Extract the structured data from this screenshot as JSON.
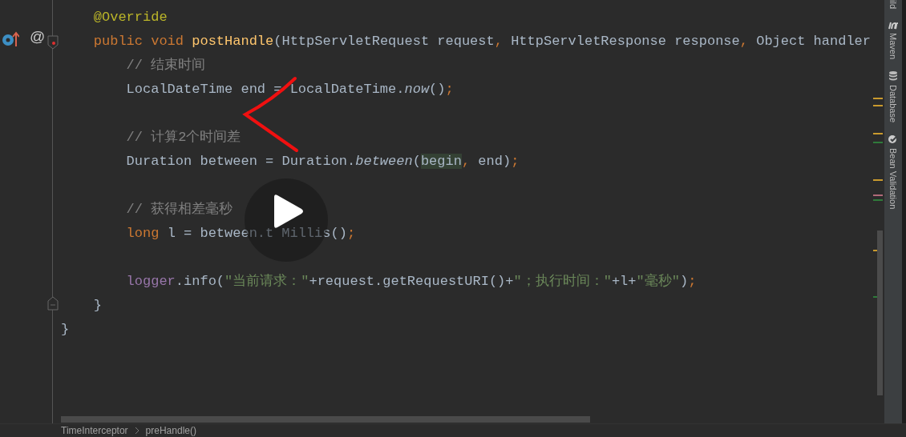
{
  "gutter": {
    "marker": "@"
  },
  "code_lines": [
    [
      {
        "t": "    @Override",
        "kind": "annotation"
      }
    ],
    [
      {
        "t": "    public void ",
        "kind": "keyword"
      },
      {
        "t": "postHandle",
        "kind": "method"
      },
      {
        "t": "(HttpServletRequest request",
        "kind": "plain"
      },
      {
        "t": ", ",
        "kind": "keyword"
      },
      {
        "t": "HttpServletResponse response",
        "kind": "plain"
      },
      {
        "t": ", ",
        "kind": "keyword"
      },
      {
        "t": "Object handler",
        "kind": "plain"
      }
    ],
    [
      {
        "t": "        // 结束时间",
        "kind": "comment"
      }
    ],
    [
      {
        "t": "        LocalDateTime end = LocalDateTime.",
        "kind": "plain"
      },
      {
        "t": "now",
        "kind": "italic"
      },
      {
        "t": "()",
        "kind": "plain"
      },
      {
        "t": ";",
        "kind": "keyword"
      }
    ],
    [
      {
        "t": "        // 计算2个时间差",
        "kind": "comment",
        "blank_before": true
      }
    ],
    [
      {
        "t": "        Duration between = Duration.",
        "kind": "plain"
      },
      {
        "t": "between",
        "kind": "italic"
      },
      {
        "t": "(",
        "kind": "plain"
      },
      {
        "t": "begin",
        "kind": "highlight"
      },
      {
        "t": ", ",
        "kind": "keyword"
      },
      {
        "t": "end)",
        "kind": "plain"
      },
      {
        "t": ";",
        "kind": "keyword"
      }
    ],
    [
      {
        "t": "        // 获得相差毫秒",
        "kind": "comment",
        "blank_before": true
      }
    ],
    [
      {
        "t": "        long ",
        "kind": "keyword"
      },
      {
        "t": "l = between.t",
        "kind": "plain"
      },
      {
        "t": "Millis()",
        "kind": "after_gap"
      },
      {
        "t": ";",
        "kind": "keyword"
      }
    ],
    [
      {
        "t": "        logger",
        "kind": "field",
        "blank_before": true
      },
      {
        "t": ".info(",
        "kind": "plain"
      },
      {
        "t": "\"当前请求：\"",
        "kind": "string"
      },
      {
        "t": "+request.getRequestURI()+",
        "kind": "plain"
      },
      {
        "t": "\"；执行时间：\"",
        "kind": "string"
      },
      {
        "t": "+l+",
        "kind": "plain"
      },
      {
        "t": "\"毫秒\"",
        "kind": "string"
      },
      {
        "t": ")",
        "kind": "plain"
      },
      {
        "t": ";",
        "kind": "keyword"
      }
    ],
    [
      {
        "t": "    }",
        "kind": "plain"
      }
    ],
    [
      {
        "t": "}",
        "kind": "plain"
      }
    ]
  ],
  "tool_windows": [
    "ild",
    "Maven",
    "Database",
    "Bean Validation"
  ],
  "breadcrumbs": [
    "TimeInterceptor",
    "preHandle()"
  ]
}
